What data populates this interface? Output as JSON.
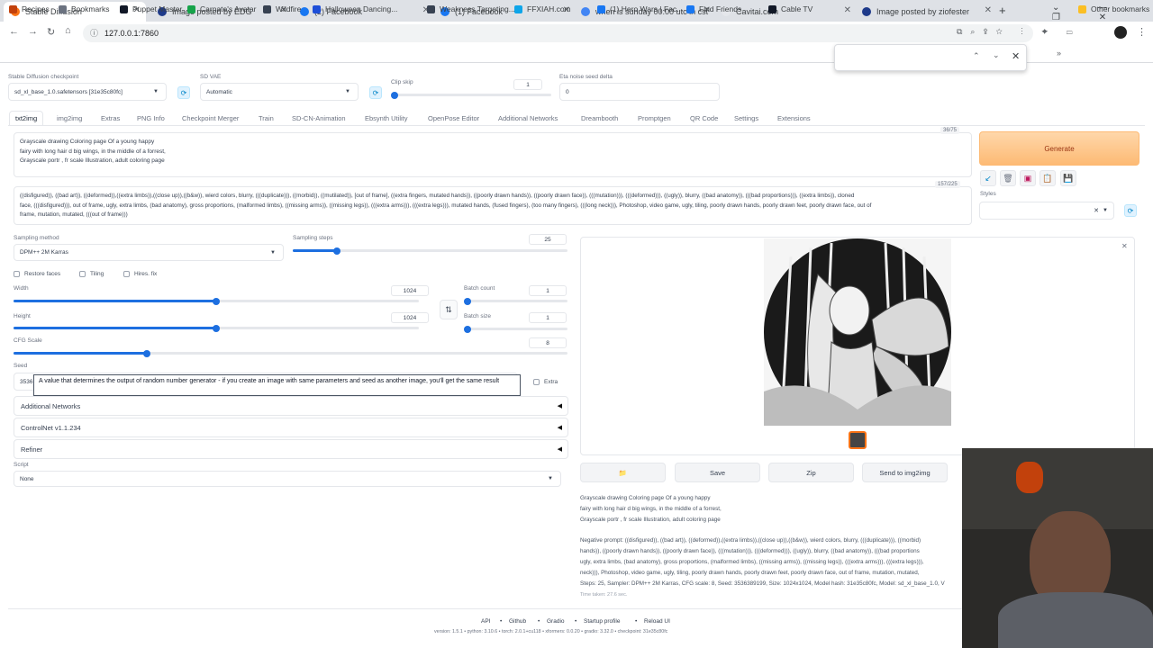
{
  "browser": {
    "tabs": [
      {
        "title": "Stable Diffusion",
        "color": "#f97316"
      },
      {
        "title": "Image posted by EDG",
        "color": "#1e3a8a"
      },
      {
        "title": "(2) Facebook",
        "color": "#1877f2"
      },
      {
        "title": "(1) Facebook",
        "color": "#1877f2"
      },
      {
        "title": "when is sunday 00:00 utc in cst",
        "color": "#4285f4"
      },
      {
        "title": "Cavitai.com",
        "color": "#e5e7eb"
      },
      {
        "title": "Image posted by ziofester",
        "color": "#1e3a8a"
      }
    ],
    "url": "127.0.0.1:7860",
    "bookmarks": [
      "Recipes",
      "Bookmarks",
      "Puppet Master",
      "Carnate's Avatar",
      "Wildfire",
      "Halloween Dancing...",
      "Weakness Targeting...",
      "FFXIAH.com",
      "(1) Hero Wars | Fac...",
      "Find Friends",
      "Cable TV"
    ],
    "other_bookmarks": "Other bookmarks"
  },
  "top": {
    "checkpoint_label": "Stable Diffusion checkpoint",
    "checkpoint_value": "sd_xl_base_1.0.safetensors [31e35c80fc]",
    "vae_label": "SD VAE",
    "vae_value": "Automatic",
    "clip_label": "Clip skip",
    "clip_value": "1",
    "eta_label": "Eta noise seed delta",
    "eta_value": "0"
  },
  "tabs": [
    "txt2img",
    "img2img",
    "Extras",
    "PNG Info",
    "Checkpoint Merger",
    "Train",
    "SD-CN-Animation",
    "Ebsynth Utility",
    "OpenPose Editor",
    "Additional Networks",
    "Dreambooth",
    "Promptgen",
    "QR Code",
    "Settings",
    "Extensions"
  ],
  "prompt": {
    "lines": [
      "Grayscale drawing Coloring page Of a young happy",
      "fairy with long hair d big wings, in the middle of a forrest,",
      "Grayscale portr , fr scale Illustration, adult coloring page"
    ],
    "counter": "36/75"
  },
  "negative": {
    "lines": [
      "((disfigured)), ((bad art)), ((deformed)),((extra limbs)),((close up)),((b&w)), wierd colors, blurry, (((duplicate))), ((morbid)), ((mutilated)), [out of frame], ((extra fingers, mutated hands)), ((poorly drawn hands)), ((poorly drawn face)), (((mutation))), (((deformed))), ((ugly)), blurry, ((bad anatomy)), (((bad proportions))), ((extra limbs)), cloned",
      "face, (((disfigured))), out of frame, ugly, extra limbs, (bad anatomy), gross proportions, (malformed limbs), ((missing arms)), ((missing legs)), (((extra arms))), (((extra legs))), mutated hands, (fused fingers), (too many fingers), (((long neck))), Photoshop, video game, ugly, tiling, poorly drawn hands, poorly drawn feet, poorly drawn face, out of",
      "frame, mutation, mutated, (((out of frame)))"
    ],
    "counter": "157/225"
  },
  "generate_label": "Generate",
  "styles_label": "Styles",
  "sampling": {
    "method_label": "Sampling method",
    "method_value": "DPM++ 2M Karras",
    "steps_label": "Sampling steps",
    "steps_value": "25",
    "steps_fraction": 0.16
  },
  "checks": [
    "Restore faces",
    "Tiling",
    "Hires. fix"
  ],
  "width": {
    "label": "Width",
    "value": "1024",
    "fraction": 0.5
  },
  "height": {
    "label": "Height",
    "value": "1024",
    "fraction": 0.5
  },
  "batch_count": {
    "label": "Batch count",
    "value": "1",
    "fraction": 0.0
  },
  "batch_size": {
    "label": "Batch size",
    "value": "1",
    "fraction": 0.0
  },
  "cfg": {
    "label": "CFG Scale",
    "value": "8",
    "fraction": 0.24
  },
  "seed": {
    "label": "Seed",
    "value": "3536",
    "extra_label": "Extra"
  },
  "tooltip": "A value that determines the output of random number generator - if you create an image with same parameters and seed as another image, you'll get the same result",
  "accordions": [
    "Additional Networks",
    "ControlNet v1.1.234",
    "Refiner"
  ],
  "script": {
    "label": "Script",
    "value": "None"
  },
  "output_buttons": [
    "Save",
    "Zip",
    "Send to img2img"
  ],
  "output_info": {
    "prompt_lines": [
      "Grayscale drawing Coloring page Of a young happy",
      "fairy with long hair d big wings, in the middle of a forrest,",
      "Grayscale portr , fr scale Illustration, adult coloring page"
    ],
    "negative_lines": [
      "Negative prompt: ((disfigured)), ((bad art)), ((deformed)),((extra limbs)),((close up)),((b&w)), wierd colors, blurry, (((duplicate))), ((morbid)",
      "hands)), ((poorly drawn hands)), ((poorly drawn face)), (((mutation))), (((deformed))), ((ugly)), blurry, ((bad anatomy)), (((bad proportions",
      "ugly, extra limbs, (bad anatomy), gross proportions, (malformed limbs), ((missing arms)), ((missing legs)), (((extra arms))), (((extra legs))),",
      "neck))), Photoshop, video game, ugly, tiling, poorly drawn hands, poorly drawn feet, poorly drawn face, out of frame, mutation, mutated,"
    ],
    "steps_line": "Steps: 25, Sampler: DPM++ 2M Karras, CFG scale: 8, Seed: 3536389199, Size: 1024x1024, Model hash: 31e35c80fc, Model: sd_xl_base_1.0, V",
    "time_taken": "Time taken: 27.6 sec."
  },
  "footer": {
    "links": [
      "API",
      "Github",
      "Gradio",
      "Startup profile",
      "Reload UI"
    ],
    "versions": "version: 1.5.1  •  python: 3.10.6  •  torch: 2.0.1+cu118  •  xformers: 0.0.20  •  gradio: 3.32.0  •  checkpoint: 31e35c80fc"
  },
  "colors": {
    "accent": "#1d6fe0",
    "generate": "#fdba74"
  }
}
